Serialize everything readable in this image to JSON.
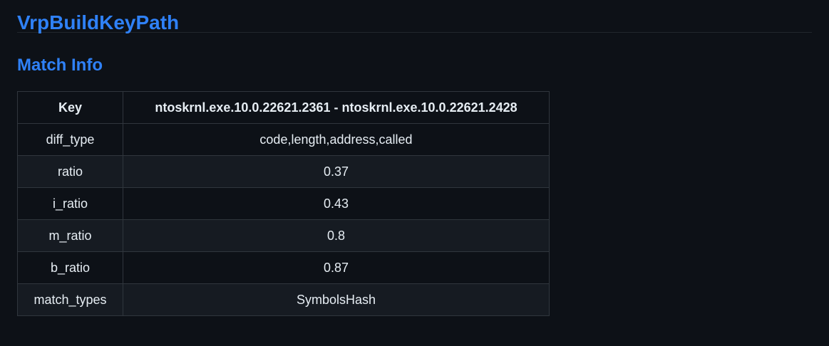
{
  "page": {
    "title": "VrpBuildKeyPath",
    "section_title": "Match Info"
  },
  "table": {
    "headers": [
      "Key",
      "ntoskrnl.exe.10.0.22621.2361 - ntoskrnl.exe.10.0.22621.2428"
    ],
    "rows": [
      [
        "diff_type",
        "code,length,address,called"
      ],
      [
        "ratio",
        "0.37"
      ],
      [
        "i_ratio",
        "0.43"
      ],
      [
        "m_ratio",
        "0.8"
      ],
      [
        "b_ratio",
        "0.87"
      ],
      [
        "match_types",
        "SymbolsHash"
      ]
    ]
  },
  "colors": {
    "background": "#0d1117",
    "heading": "#2f81f7",
    "text": "#e6edf3",
    "border": "#30363d",
    "row_alt": "#161b22"
  }
}
